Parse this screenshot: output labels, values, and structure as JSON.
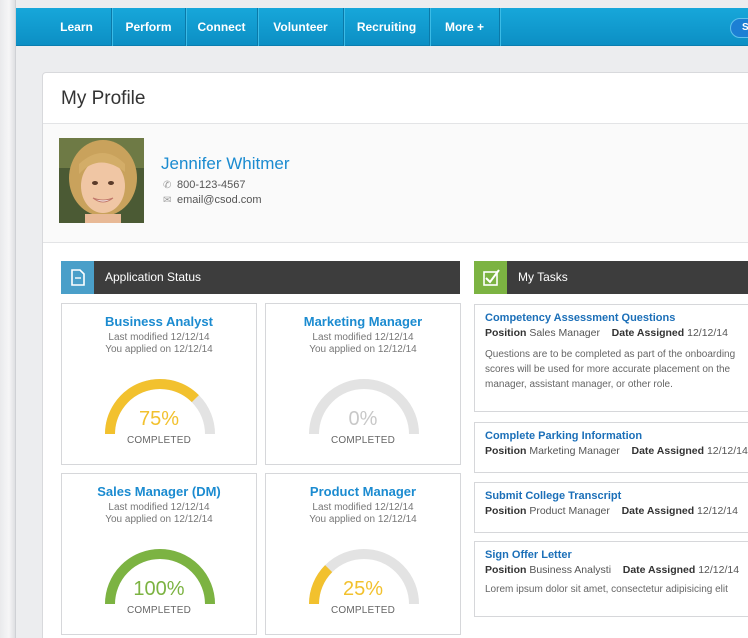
{
  "nav": {
    "items": [
      "Learn",
      "Perform",
      "Connect",
      "Volunteer",
      "Recruiting",
      "More +"
    ],
    "search_label": "Se"
  },
  "page": {
    "title": "My Profile"
  },
  "profile": {
    "name": "Jennifer Whitmer",
    "phone": "800-123-4567",
    "email": "email@csod.com"
  },
  "application_status": {
    "title": "Application Status",
    "cards": [
      {
        "title": "Business Analyst",
        "modified": "Last modified 12/12/14",
        "applied": "You applied on 12/12/14",
        "percent": "75%",
        "progress": 0.75,
        "status": "COMPLETED",
        "color": "#f2c12e"
      },
      {
        "title": "Marketing Manager",
        "modified": "Last modified 12/12/14",
        "applied": "You applied on 12/12/14",
        "percent": "0%",
        "progress": 0,
        "status": "COMPLETED",
        "color": "#cccccc"
      },
      {
        "title": "Sales Manager (DM)",
        "modified": "Last modified 12/12/14",
        "applied": "You applied on 12/12/14",
        "percent": "100%",
        "progress": 1.0,
        "status": "COMPLETED",
        "color": "#7cb342"
      },
      {
        "title": "Product Manager",
        "modified": "Last modified 12/12/14",
        "applied": "You applied on 12/12/14",
        "percent": "25%",
        "progress": 0.25,
        "status": "COMPLETED",
        "color": "#f2c12e"
      }
    ]
  },
  "tasks": {
    "title": "My Tasks",
    "position_label": "Position",
    "date_label": "Date Assigned",
    "items": [
      {
        "title": "Competency Assessment Questions",
        "position": "Sales Manager",
        "date": "12/12/14",
        "desc": [
          "Questions are to be completed as part of the onboarding",
          "scores will be used for more accurate placement on the",
          "manager, assistant manager, or other role."
        ]
      },
      {
        "title": "Complete Parking Information",
        "position": "Marketing Manager",
        "date": "12/12/14"
      },
      {
        "title": "Submit College Transcript",
        "position": "Product Manager",
        "date": "12/12/14"
      },
      {
        "title": "Sign Offer Letter",
        "position": "Business Analysti",
        "date": "12/12/14",
        "desc": [
          "Lorem ipsum dolor sit amet, consectetur adipisicing elit"
        ]
      }
    ]
  },
  "colors": {
    "accent": "#1b8bd0",
    "nav": "#17a7da",
    "app_status_icon": "#4a9fc9",
    "tasks_icon": "#7cb342",
    "header_dark": "#3d3d3d"
  }
}
